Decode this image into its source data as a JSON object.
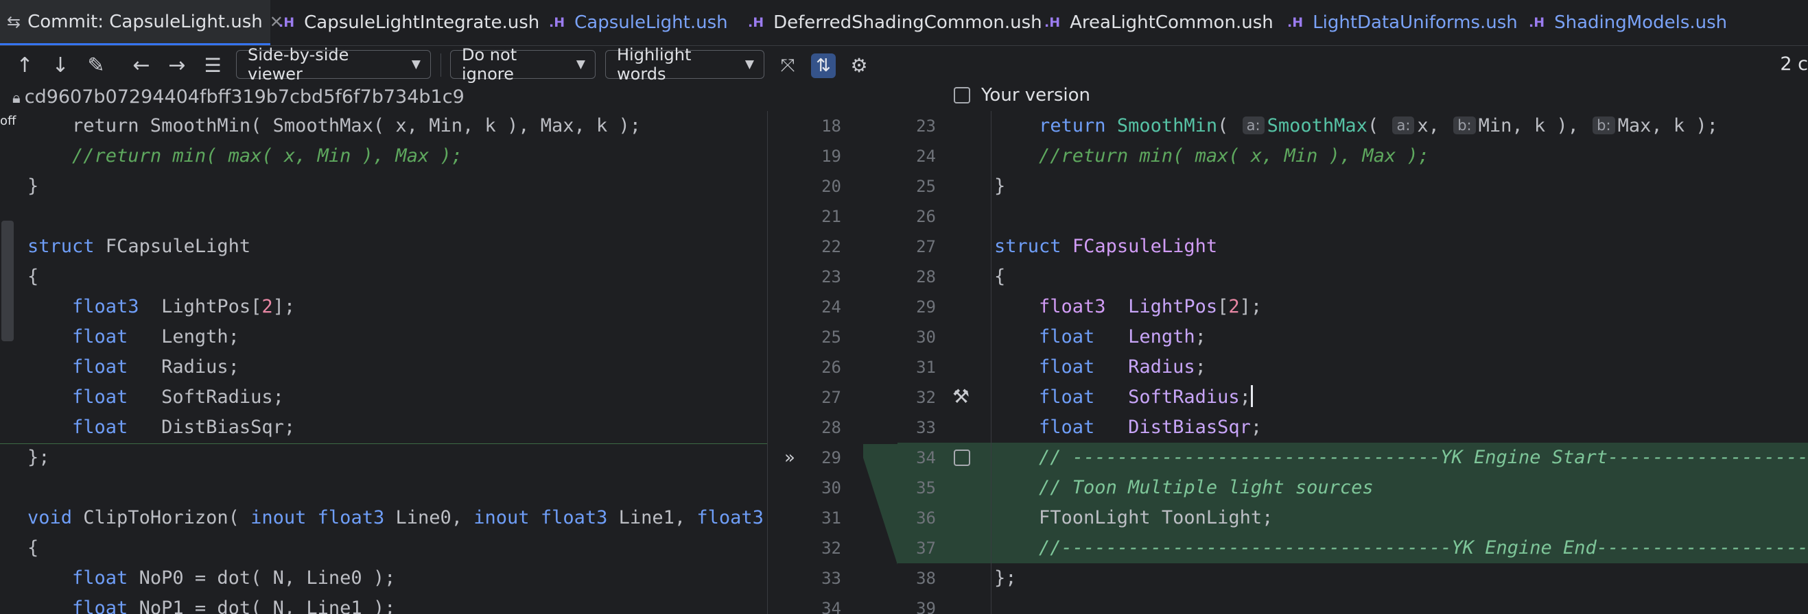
{
  "tabs": [
    {
      "label": "Commit: CapsuleLight.ush",
      "icon": "diff-icon",
      "active": true
    },
    {
      "label": "CapsuleLightIntegrate.ush",
      "icon_text": ".H",
      "style": "plain"
    },
    {
      "label": "CapsuleLight.ush",
      "icon_text": ".H",
      "style": "scope"
    },
    {
      "label": "DeferredShadingCommon.ush",
      "icon_text": ".H",
      "style": "plain"
    },
    {
      "label": "AreaLightCommon.ush",
      "icon_text": ".H",
      "style": "plain"
    },
    {
      "label": "LightDataUniforms.ush",
      "icon_text": ".H",
      "style": "scope"
    },
    {
      "label": "ShadingModels.ush",
      "icon_text": ".H",
      "style": "scope"
    }
  ],
  "toolbar": {
    "viewer": "Side-by-side viewer",
    "ignore": "Do not ignore",
    "highlight": "Highlight words",
    "count": "2 c"
  },
  "info": {
    "hash": "cd9607b07294404fbff319b7cbd5f6f7b734b1c9",
    "your_version": "Your version",
    "off": "off"
  },
  "colors": {
    "background": "#1e1f22",
    "added_line": "#294436",
    "accent": "#3574f0"
  }
}
